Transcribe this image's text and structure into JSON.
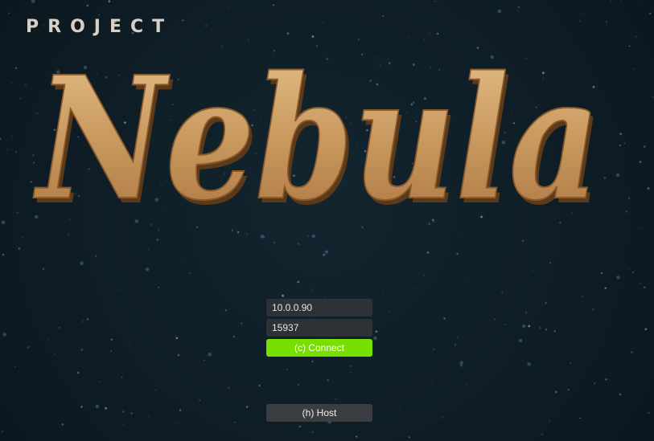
{
  "title": {
    "prefix": "PROJECT",
    "logo_text": "Nebula"
  },
  "connection": {
    "ip_value": "10.0.0.90",
    "port_value": "15937",
    "connect_label": "(c) Connect",
    "host_label": "(h) Host"
  },
  "colors": {
    "background": "#0d1a22",
    "logo_gold": "#c9995f",
    "connect_green": "#78e000",
    "field_bg": "#2e3236",
    "host_bg": "#3a3d41"
  }
}
